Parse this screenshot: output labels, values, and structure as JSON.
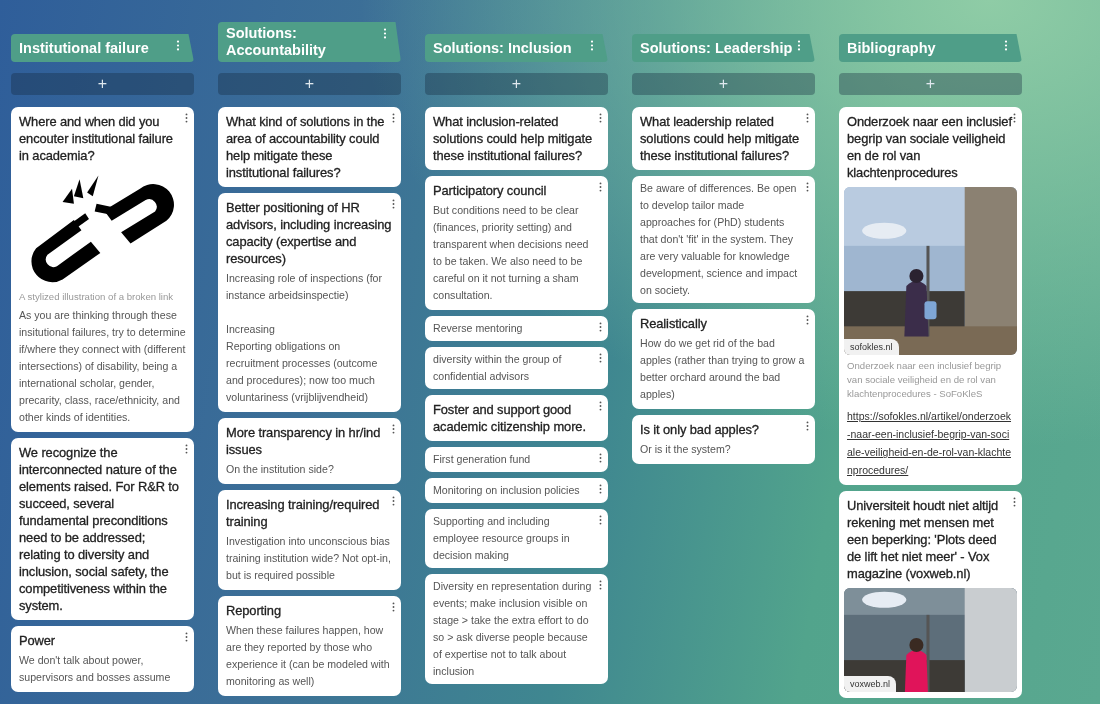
{
  "columns": [
    {
      "title": "Institutional failure",
      "add_label": "+",
      "cards": [
        {
          "title": "Where and when did you encouter institutional failure in academia?",
          "attachment": {
            "kind": "illustration",
            "caption": "A stylized illustration of a broken link"
          },
          "body": "As you are thinking through these insitutional failures, try to determine if/where they connect with (different intersections) of disability, being a international scholar, gender, precarity, class, race/ethnicity, and other kinds of identities."
        },
        {
          "title": "We recognize the interconnected nature of the elements raised. For R&R to succeed, several fundamental preconditions need to be addressed; relating to diversity and inclusion, social safety, the competitiveness within the system."
        },
        {
          "title": "Power",
          "body": "We don't talk about power, supervisors and bosses assume"
        }
      ]
    },
    {
      "title": "Solutions: Accountability",
      "add_label": "+",
      "cards": [
        {
          "title": "What kind of solutions in the area of accountability could help mitigate these institutional failures?"
        },
        {
          "title": "Better positioning of HR advisors, including increasing capacity (expertise and resources)",
          "body": "Increasing role of inspections (for instance arbeidsinspectie)\n\nIncreasing\nReporting obligations on recruitment processes (outcome and procedures); now too much voluntariness (vrijblijvendheid)"
        },
        {
          "title": "More transparency in hr/ind issues",
          "body": "On the institution side?"
        },
        {
          "title": "Increasing training/required training",
          "body": "Investigation into unconscious bias training institution wide? Not opt-in, but is required possible"
        },
        {
          "title": "Reporting",
          "body": "When these failures happen, how are they reported by those who experience it (can be modeled with monitoring as well)"
        }
      ]
    },
    {
      "title": "Solutions: Inclusion",
      "add_label": "+",
      "cards": [
        {
          "title": "What inclusion-related solutions could help mitigate these institutional failures?"
        },
        {
          "title": "Participatory council",
          "body": "But conditions need to be clear (finances, priority setting) and transparent when decisions need to be taken. We also need to be careful on it not turning a sham consultation."
        },
        {
          "body": "Reverse mentoring"
        },
        {
          "body": "diversity within the group of confidential advisors"
        },
        {
          "title": "Foster and support good academic citizenship more."
        },
        {
          "body": "First generation fund"
        },
        {
          "body": "Monitoring on inclusion policies"
        },
        {
          "body": "Supporting and including employee resource groups in decision making"
        },
        {
          "body": "Diversity en representation during events; make inclusion visible on stage > take the extra effort to do so > ask diverse people because of expertise not to talk about inclusion"
        }
      ]
    },
    {
      "title": "Solutions: Leadership",
      "add_label": "+",
      "cards": [
        {
          "title": "What leadership related solutions could help mitigate these institutional failures?"
        },
        {
          "body": "Be aware of differences. Be open to develop tailor made approaches for (PhD) students that don't 'fit' in the system. They are very valuable for knowledge development, science and impact on society."
        },
        {
          "title": "Realistically",
          "body": "How do we get rid of the bad apples (rather than trying to grow a better orchard around the bad apples)"
        },
        {
          "title": "Is it only bad apples?",
          "body": "Or is it the system?"
        }
      ]
    },
    {
      "title": "Bibliography",
      "add_label": "+",
      "cards": [
        {
          "title": "Onderzoek naar een inclusief begrip van sociale veiligheid en de rol van klachtenprocedures",
          "attachment": {
            "kind": "picture",
            "source": "sofokles.nl",
            "caption": "Onderzoek naar een inclusief begrip van sociale veiligheid en de rol van klachtenprocedures - SoFoKleS"
          },
          "link": "https://sofokles.nl/artikel/onderzoek-naar-een-inclusief-begrip-van-sociale-veiligheid-en-de-rol-van-klachtenprocedures/"
        },
        {
          "title": "Universiteit houdt niet altijd rekening met mensen met een beperking: 'Plots deed de lift het niet meer' - Vox magazine (voxweb.nl)",
          "attachment": {
            "kind": "picture",
            "source": "voxweb.nl"
          }
        }
      ]
    }
  ]
}
